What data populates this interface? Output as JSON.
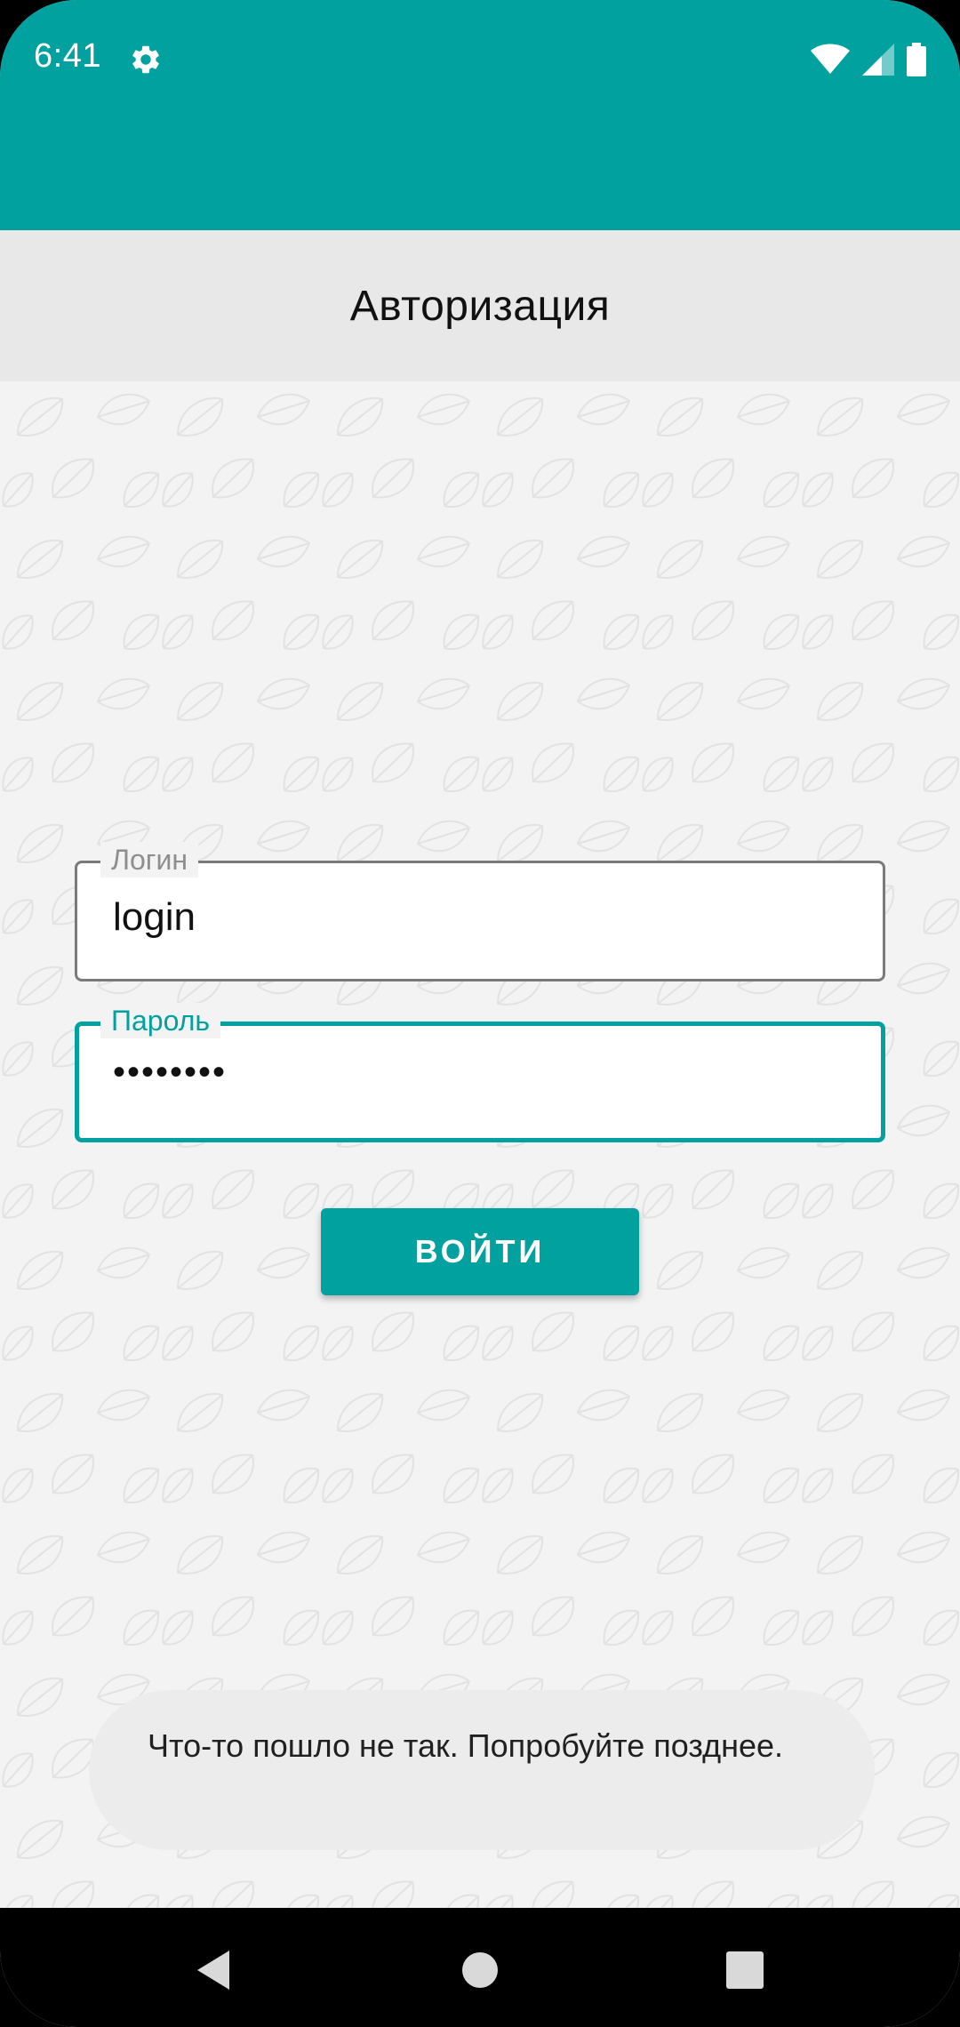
{
  "status_bar": {
    "time": "6:41",
    "icons": [
      "settings-gear-icon",
      "wifi-icon",
      "cellular-signal-icon",
      "battery-icon"
    ]
  },
  "colors": {
    "accent": "#00a19e",
    "title_bar_bg": "#e8e8e8",
    "content_bg": "#f3f3f3",
    "nav_bar_bg": "#000000"
  },
  "header": {
    "title": "Авторизация"
  },
  "form": {
    "login_label": "Логин",
    "login_value": "login",
    "password_label": "Пароль",
    "password_value": "••••••••",
    "submit_label": "ВОЙТИ"
  },
  "toast": {
    "message": "Что-то пошло не так. Попробуйте позднее."
  },
  "nav": {
    "buttons": [
      "back-icon",
      "home-icon",
      "recents-icon"
    ]
  }
}
